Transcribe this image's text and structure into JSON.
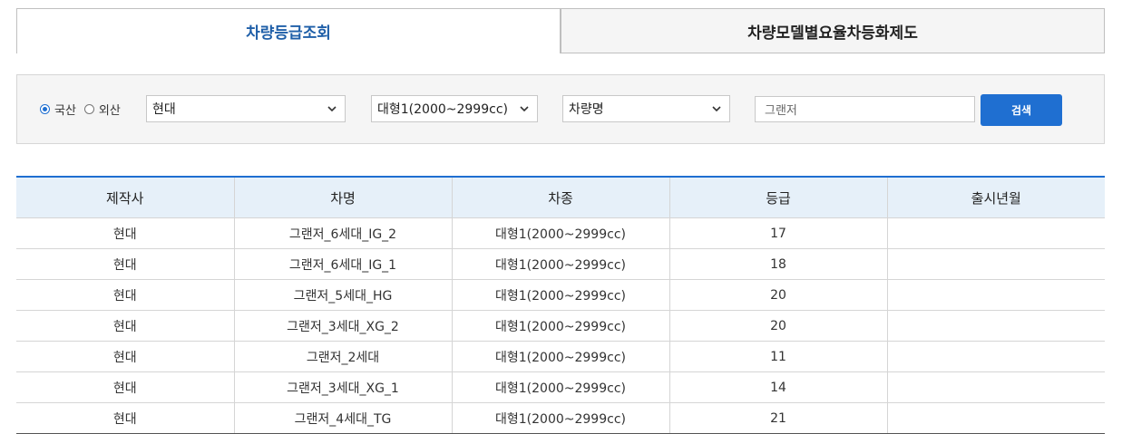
{
  "tabs": [
    {
      "label": "차량등급조회",
      "active": true
    },
    {
      "label": "차량모델별요율차등화제도",
      "active": false
    }
  ],
  "search": {
    "radio_options": [
      {
        "label": "국산",
        "checked": true
      },
      {
        "label": "외산",
        "checked": false
      }
    ],
    "maker_select": "현대",
    "class_select": "대형1(2000~2999cc)",
    "name_select": "차량명",
    "keyword_value": "그랜저",
    "search_button": "검색"
  },
  "table": {
    "headers": [
      "제작사",
      "차명",
      "차종",
      "등급",
      "출시년월"
    ],
    "rows": [
      [
        "현대",
        "그랜저_6세대_IG_2",
        "대형1(2000~2999cc)",
        "17",
        ""
      ],
      [
        "현대",
        "그랜저_6세대_IG_1",
        "대형1(2000~2999cc)",
        "18",
        ""
      ],
      [
        "현대",
        "그랜저_5세대_HG",
        "대형1(2000~2999cc)",
        "20",
        ""
      ],
      [
        "현대",
        "그랜저_3세대_XG_2",
        "대형1(2000~2999cc)",
        "20",
        ""
      ],
      [
        "현대",
        "그랜저_2세대",
        "대형1(2000~2999cc)",
        "11",
        ""
      ],
      [
        "현대",
        "그랜저_3세대_XG_1",
        "대형1(2000~2999cc)",
        "14",
        ""
      ],
      [
        "현대",
        "그랜저_4세대_TG",
        "대형1(2000~2999cc)",
        "21",
        ""
      ]
    ]
  },
  "colors": {
    "accent": "#1f6fd1",
    "tab_active_text": "#1f5fa8",
    "header_bg": "#e6f0f9"
  }
}
